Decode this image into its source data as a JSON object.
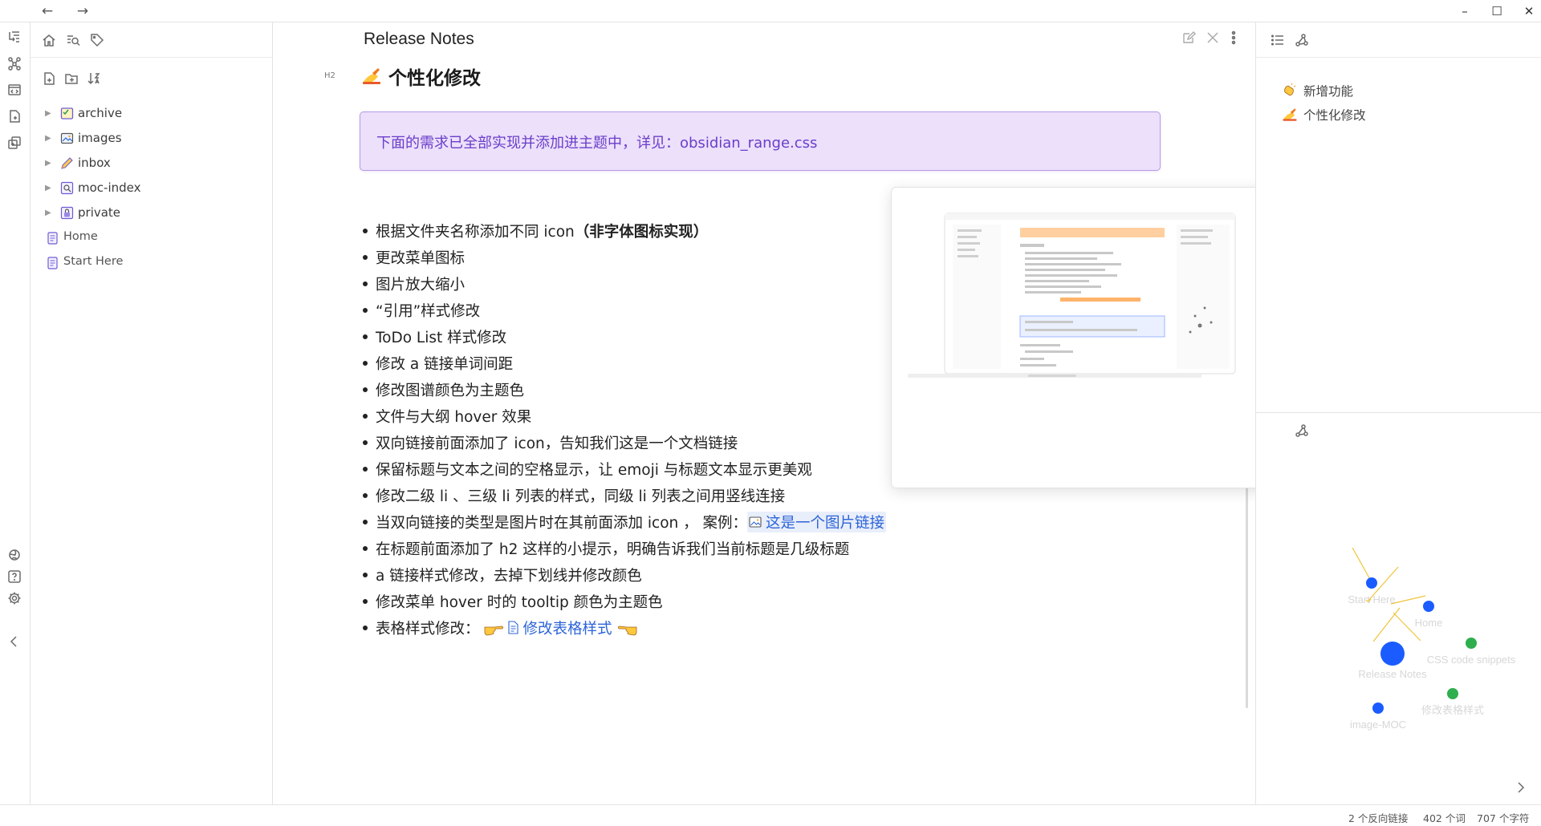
{
  "window": {
    "back_icon": "←",
    "forward_icon": "→",
    "minimize_icon": "–",
    "maximize_icon": "☐",
    "close_icon": "✕"
  },
  "explorer": {
    "items": [
      {
        "type": "folder",
        "label": "archive",
        "icon": "archive-box-icon"
      },
      {
        "type": "folder",
        "label": "images",
        "icon": "image-icon"
      },
      {
        "type": "folder",
        "label": "inbox",
        "icon": "pencil-icon"
      },
      {
        "type": "folder",
        "label": "moc-index",
        "icon": "index-icon"
      },
      {
        "type": "folder",
        "label": "private",
        "icon": "lock-icon"
      },
      {
        "type": "file",
        "label": "Home",
        "icon": "note-icon"
      },
      {
        "type": "file",
        "label": "Start Here",
        "icon": "note-icon"
      }
    ]
  },
  "editor": {
    "view_title": "Release Notes",
    "h2_tag": "H2",
    "heading": "个性化修改",
    "callout": "下面的需求已全部实现并添加进主题中，详见：obsidian_range.css",
    "items": [
      {
        "text": "根据文件夹名称添加不同 icon",
        "bold": "（非字体图标实现）"
      },
      {
        "text": "更改菜单图标"
      },
      {
        "text": "图片放大缩小"
      },
      {
        "text": "“引用”样式修改"
      },
      {
        "text": "ToDo List 样式修改"
      },
      {
        "text": "修改 a 链接单词间距"
      },
      {
        "text": "修改图谱颜色为主题色"
      },
      {
        "text": "文件与大纲 hover 效果"
      },
      {
        "text": "双向链接前面添加了 icon，告知我们这是一个文档链接"
      },
      {
        "text": "保留标题与文本之间的空格显示，让 emoji 与标题文本显示更美观"
      },
      {
        "text": "修改二级 li 、三级 li 列表的样式，同级 li 列表之间用竖线连接"
      },
      {
        "text": "当双向链接的类型是图片时在其前面添加 icon ， 案例：",
        "link": "这是一个图片链接"
      },
      {
        "text": "在标题前面添加了 h2 这样的小提示，明确告诉我们当前标题是几级标题"
      },
      {
        "text": "a 链接样式修改，去掉下划线并修改颜色"
      },
      {
        "text": "修改菜单 hover 时的 tooltip 颜色为主题色"
      },
      {
        "text": "表格样式修改：",
        "link": "修改表格样式"
      }
    ]
  },
  "outline": {
    "items": [
      {
        "label": "新增功能",
        "icon": "clap-icon"
      },
      {
        "label": "个性化修改",
        "icon": "writing-hand-icon"
      }
    ]
  },
  "graph": {
    "nodes": [
      {
        "label": "Start Here",
        "color": "#1a5cff"
      },
      {
        "label": "Home",
        "color": "#1a5cff"
      },
      {
        "label": "Release Notes",
        "color": "#1a5cff"
      },
      {
        "label": "CSS code snippets",
        "color": "#2fae4e"
      },
      {
        "label": "修改表格样式",
        "color": "#2fae4e"
      },
      {
        "label": "image-MOC",
        "color": "#1a5cff"
      }
    ]
  },
  "status": {
    "backlinks": "2 个反向链接",
    "words": "402 个词",
    "chars": "707 个字符"
  },
  "colors": {
    "accent": "#6b3ec9",
    "callout_bg": "#ece0fb",
    "link": "#2c64d8",
    "graph_blue": "#1a5cff",
    "graph_green": "#2fae4e",
    "graph_edge": "#f0c43a"
  }
}
